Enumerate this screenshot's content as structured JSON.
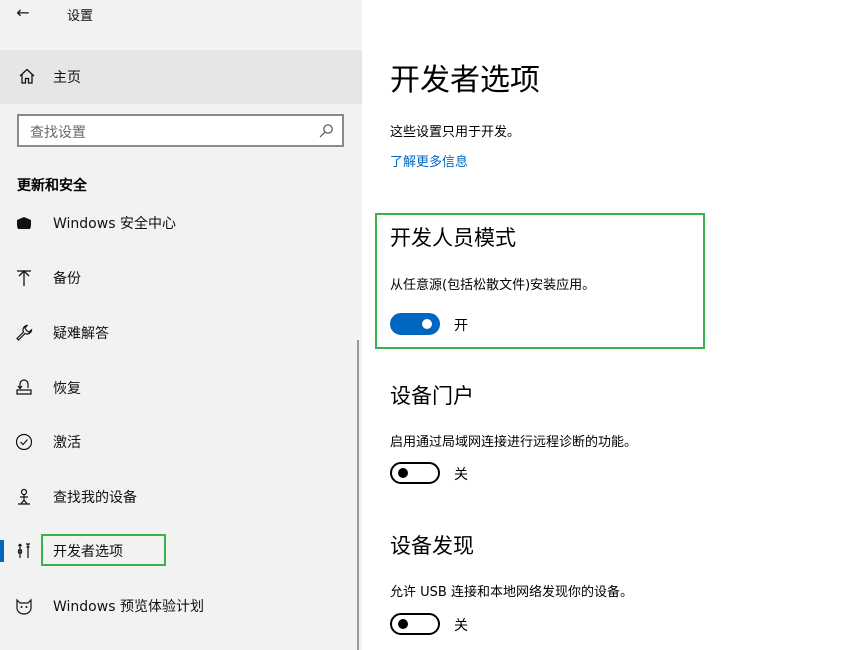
{
  "window": {
    "title": "设置"
  },
  "sidebar": {
    "home_label": "主页",
    "search_placeholder": "查找设置",
    "section_header": "更新和安全",
    "items": [
      {
        "label": "Windows 安全中心",
        "icon": "shield-icon"
      },
      {
        "label": "备份",
        "icon": "backup-arrow-icon"
      },
      {
        "label": "疑难解答",
        "icon": "wrench-icon"
      },
      {
        "label": "恢复",
        "icon": "recovery-icon"
      },
      {
        "label": "激活",
        "icon": "check-circle-icon"
      },
      {
        "label": "查找我的设备",
        "icon": "person-locate-icon"
      },
      {
        "label": "开发者选项",
        "icon": "developer-tools-icon",
        "selected": true
      },
      {
        "label": "Windows 预览体验计划",
        "icon": "insider-cat-icon"
      }
    ]
  },
  "main": {
    "title": "开发者选项",
    "description": "这些设置只用于开发。",
    "learn_more": "了解更多信息",
    "sections": [
      {
        "heading": "开发人员模式",
        "description": "从任意源(包括松散文件)安装应用。",
        "toggle_state": "on",
        "toggle_label": "开"
      },
      {
        "heading": "设备门户",
        "description": "启用通过局域网连接进行远程诊断的功能。",
        "toggle_state": "off",
        "toggle_label": "关"
      },
      {
        "heading": "设备发现",
        "description": "允许 USB 连接和本地网络发现你的设备。",
        "toggle_state": "off",
        "toggle_label": "关"
      }
    ]
  },
  "colors": {
    "accent": "#0067c0",
    "highlight_box": "#37b24d",
    "sidebar_bg": "#f2f2f2"
  }
}
